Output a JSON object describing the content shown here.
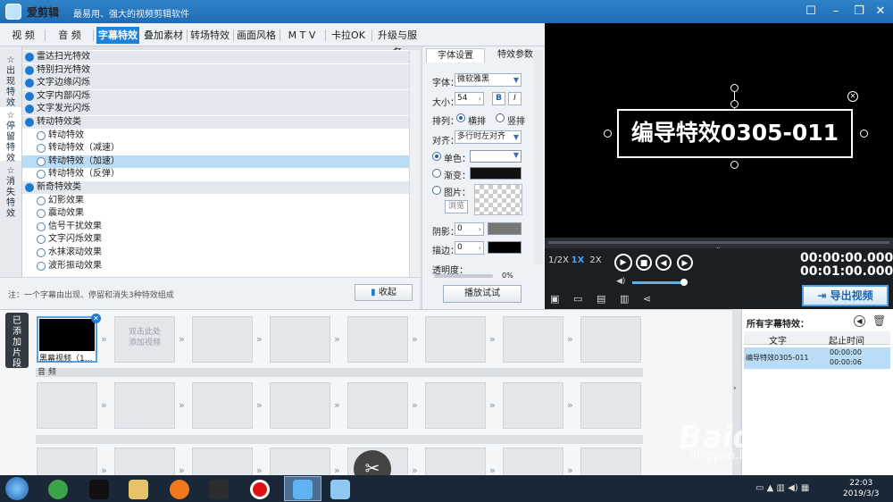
{
  "app": {
    "name": "爱剪辑",
    "slogan": "最易用、强大的视频剪辑软件"
  },
  "menu": {
    "tabs": [
      "视 频",
      "音 频",
      "字幕特效",
      "叠加素材",
      "转场特效",
      "画面风格",
      "M T V",
      "卡拉OK",
      "升级与服务"
    ],
    "active": "字幕特效"
  },
  "left_tabs": [
    "出现特效",
    "停留特效",
    "消失特效"
  ],
  "effects": [
    {
      "type": "cat",
      "label": "雷达扫光特效"
    },
    {
      "type": "cat",
      "label": "特别扫光特效"
    },
    {
      "type": "cat",
      "label": "文字边缘闪烁"
    },
    {
      "type": "cat",
      "label": "文字内部闪烁"
    },
    {
      "type": "cat",
      "label": "文字发光闪烁"
    },
    {
      "type": "cat",
      "label": "转动特效类"
    },
    {
      "type": "item",
      "label": "转动特效"
    },
    {
      "type": "item",
      "label": "转动特效（减速）"
    },
    {
      "type": "item",
      "label": "转动特效（加速）",
      "selected": true
    },
    {
      "type": "item",
      "label": "转动特效（反弹）"
    },
    {
      "type": "cat",
      "label": "新奇特效类"
    },
    {
      "type": "item",
      "label": "幻影效果"
    },
    {
      "type": "item",
      "label": "震动效果"
    },
    {
      "type": "item",
      "label": "信号干扰效果"
    },
    {
      "type": "item",
      "label": "文字闪烁效果"
    },
    {
      "type": "item",
      "label": "水抹滚动效果"
    },
    {
      "type": "item",
      "label": "波形振动效果"
    }
  ],
  "note": "注：一个字幕由出现、停留和消失3种特效组成",
  "collapse_label": "收起",
  "settings": {
    "tabs": [
      "字体设置",
      "特效参数"
    ],
    "font_label": "字体：",
    "font_value": "微软雅黑",
    "size_label": "大小：",
    "size_value": "54",
    "bold": "B",
    "italic": "I",
    "layout_label": "排列：",
    "layout_h": "横排",
    "layout_v": "竖排",
    "align_label": "对齐：",
    "align_value": "多行时左对齐",
    "solid_label": "单色：",
    "gradient_label": "渐变：",
    "image_label": "图片：",
    "browse_label": "浏览",
    "shadow_label": "阴影：",
    "shadow_value": "0",
    "stroke_label": "描边：",
    "stroke_value": "0",
    "opacity_label": "透明度：",
    "opacity_value": "0%",
    "play_test": "播放试试"
  },
  "preview": {
    "caption": "编导特效0305-011",
    "speeds": [
      "1/2X",
      "1X",
      "2X"
    ],
    "active_speed": "1X",
    "time_current": "00:00:00.000",
    "time_total": "00:01:00.000",
    "progress": 0.0,
    "volume": 0.75
  },
  "export_label": "导出视频",
  "timeline": {
    "added_label": "已添加片段",
    "clip_name": "黑幕视频（1...",
    "hint": "双击此处\n添加视频",
    "audio_label": "音 频"
  },
  "subtitles": {
    "title": "所有字幕特效：",
    "col_text": "文字",
    "col_time": "起止时间",
    "rows": [
      {
        "text": "编导特效0305-011",
        "start": "00:00:00",
        "end": "00:00:06"
      }
    ]
  },
  "taskbar": {
    "time": "22:03",
    "date": "2019/3/3"
  },
  "watermark": {
    "logo": "Baidu经验",
    "url": "jingyan.baidu.com"
  },
  "colors": {
    "accent": "#1e83d6",
    "title": "#2a7cc4"
  }
}
